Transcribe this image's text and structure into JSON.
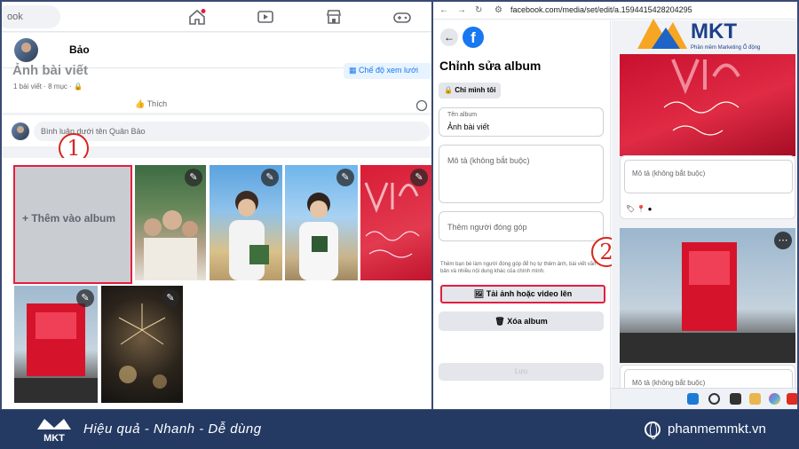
{
  "left": {
    "search_placeholder": "ook",
    "profile_name": "Bảo",
    "ghost_title": "Ảnh bài viết",
    "meta": "1 bài viết · 8 mục ·",
    "view_button": "Chế độ xem lưới",
    "like_label": "Thích",
    "comment_placeholder": "Bình luận dưới tên Quân Bảo",
    "add_to_album": "+ Thêm vào album",
    "step_marker": "1"
  },
  "right": {
    "url": "facebook.com/media/set/edit/a.1594415428204295",
    "title": "Chỉnh sửa album",
    "privacy": "Chỉ mình tôi",
    "album_name_label": "Tên album",
    "album_name_value": "Ảnh bài viết",
    "description_placeholder": "Mô tả (không bắt buộc)",
    "add_contributor": "Thêm người đóng góp",
    "help_text": "Thêm bạn bè làm người đóng góp để họ tự thêm ảnh, bài viết văn bản và nhiều nội dung khác của chính mình.",
    "upload_button": "Tải ảnh hoặc video lên",
    "delete_button": "Xóa album",
    "save_button": "Lưu",
    "step_marker": "2",
    "feed_description_1": "Mô tả (không bắt buộc)",
    "feed_description_2": "Mô tả (không bắt buộc)",
    "brand_name": "MKT",
    "brand_sub": "Phần mềm Marketing Ổ động"
  },
  "footer": {
    "slogan": "Hiệu quả - Nhanh - Dễ dùng",
    "website": "phanmemmkt.vn",
    "logo_text": "MKT"
  },
  "colors": {
    "facebook_blue": "#1877f2",
    "highlight_red": "#e41e3f",
    "footer_navy": "#243a63"
  }
}
